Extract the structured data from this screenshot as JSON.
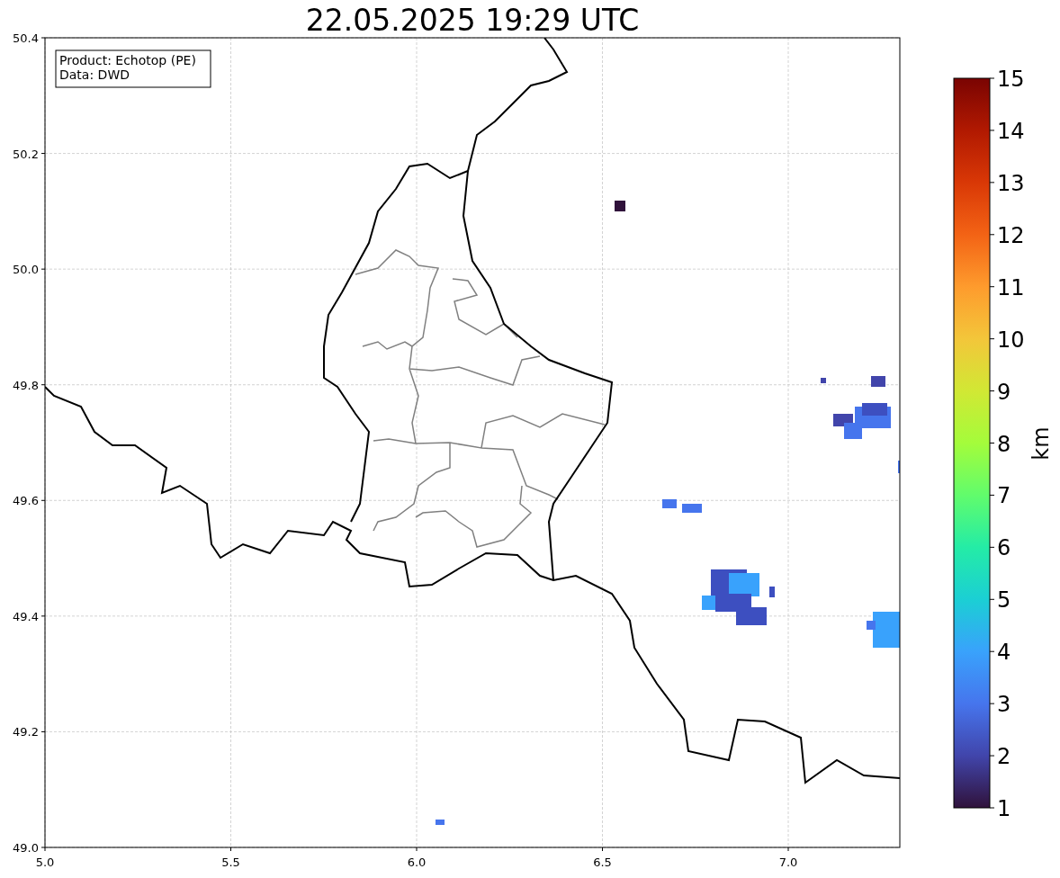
{
  "title": "22.05.2025 19:29 UTC",
  "info_box": [
    "Product: Echotop (PE)",
    "Data: DWD"
  ],
  "x_ticks": [
    "5.0",
    "5.5",
    "6.0",
    "6.5",
    "7.0"
  ],
  "y_ticks": [
    "50.4",
    "50.2",
    "50.0",
    "49.8",
    "49.6",
    "49.4",
    "49.2",
    "49.0"
  ],
  "colorbar": {
    "label": "km",
    "ticks": [
      "15",
      "14",
      "13",
      "12",
      "11",
      "10",
      "9",
      "8",
      "7",
      "6",
      "5",
      "4",
      "3",
      "2",
      "1"
    ]
  }
}
